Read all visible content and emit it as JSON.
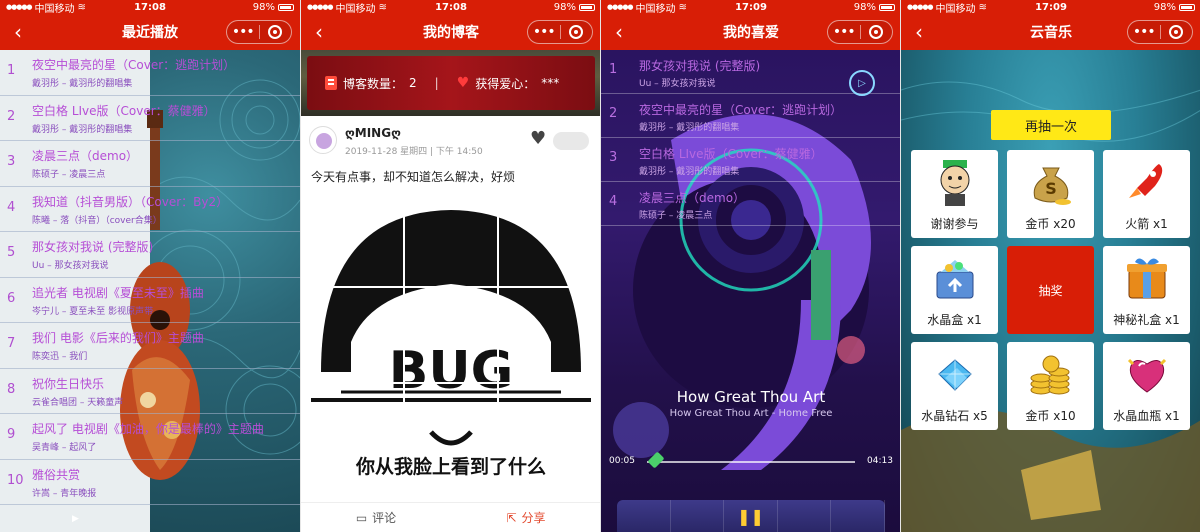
{
  "status_bar": {
    "carrier": "中国移动",
    "battery": "98%"
  },
  "capsule": {
    "more": "•••"
  },
  "panel1": {
    "time": "17:08",
    "title": "最近播放",
    "songs": [
      {
        "num": "1",
        "title": "夜空中最亮的星（Cover：逃跑计划）",
        "sub": "戴羽彤 – 戴羽彤的翻唱集"
      },
      {
        "num": "2",
        "title": "空白格 LIve版（Cover：蔡健雅）",
        "sub": "戴羽彤 – 戴羽彤的翻唱集"
      },
      {
        "num": "3",
        "title": "凌晨三点（demo）",
        "sub": "陈硕子 – 凌晨三点"
      },
      {
        "num": "4",
        "title": "我知道（抖音男版）（Cover：By2）",
        "sub": "陈曦 – 落（抖音）（cover合集）"
      },
      {
        "num": "5",
        "title": "那女孩对我说 (完整版)",
        "sub": "Uu – 那女孩对我说"
      },
      {
        "num": "6",
        "title": "追光者 电视剧《夏至未至》插曲",
        "sub": "岑宁儿 – 夏至未至 影视原声带"
      },
      {
        "num": "7",
        "title": "我们 电影《后来的我们》主题曲",
        "sub": "陈奕迅 – 我们"
      },
      {
        "num": "8",
        "title": "祝你生日快乐",
        "sub": "云雀合唱团 – 天籁童声"
      },
      {
        "num": "9",
        "title": "起风了 电视剧《加油，你是最棒的》主题曲",
        "sub": "吴青峰 – 起风了"
      },
      {
        "num": "10",
        "title": "雅俗共赏",
        "sub": "许嵩 – 青年晚报"
      }
    ],
    "play_glyph": "▶"
  },
  "panel2": {
    "time": "17:08",
    "title": "我的博客",
    "blog_count_label": "博客数量：",
    "blog_count": "2",
    "love_label": "获得爱心：",
    "love_value": "***",
    "author": "ღMINGღ",
    "post_time": "2019-11-28 星期四 | 下午 14:50",
    "post_text": "今天有点事，却不知道怎么解决，好烦",
    "meme_text": "BUG",
    "meme_caption": "你从我脸上看到了什么",
    "comment": "评论",
    "share": "分享"
  },
  "panel3": {
    "time": "17:09",
    "title": "我的喜爱",
    "songs": [
      {
        "num": "1",
        "title": "那女孩对我说 (完整版)",
        "sub": "Uu – 那女孩对我说"
      },
      {
        "num": "2",
        "title": "夜空中最亮的星（Cover：逃跑计划）",
        "sub": "戴羽彤 – 戴羽彤的翻唱集"
      },
      {
        "num": "3",
        "title": "空白格 LIve版（Cover：蔡健雅）",
        "sub": "戴羽彤 – 戴羽彤的翻唱集"
      },
      {
        "num": "4",
        "title": "凌晨三点（demo）",
        "sub": "陈硕子 – 凌晨三点"
      }
    ],
    "now_title": "How Great Thou Art",
    "now_sub": "How Great Thou Art - Home Free",
    "elapsed": "00:05",
    "total": "04:13",
    "progress": 0.02
  },
  "panel4": {
    "time": "17:09",
    "title": "云音乐",
    "redraw": "再抽一次",
    "prizes": [
      {
        "label": "谢谢参与",
        "icon": "meme-face-icon"
      },
      {
        "label": "金币 x20",
        "icon": "money-bag-icon"
      },
      {
        "label": "火箭 x1",
        "icon": "rocket-icon"
      },
      {
        "label": "水晶盒 x1",
        "icon": "crystal-box-icon"
      },
      {
        "label": "抽奖",
        "icon": ""
      },
      {
        "label": "神秘礼盒 x1",
        "icon": "gift-box-icon"
      },
      {
        "label": "水晶钻石 x5",
        "icon": "crystal-diamond-icon"
      },
      {
        "label": "金币 x10",
        "icon": "gold-coins-icon"
      },
      {
        "label": "水晶血瓶 x1",
        "icon": "crystal-heart-icon"
      }
    ]
  },
  "colors": {
    "brand_red": "#d81e06",
    "song_purple": "#b64ed6",
    "redraw_yellow": "#ffe816"
  }
}
